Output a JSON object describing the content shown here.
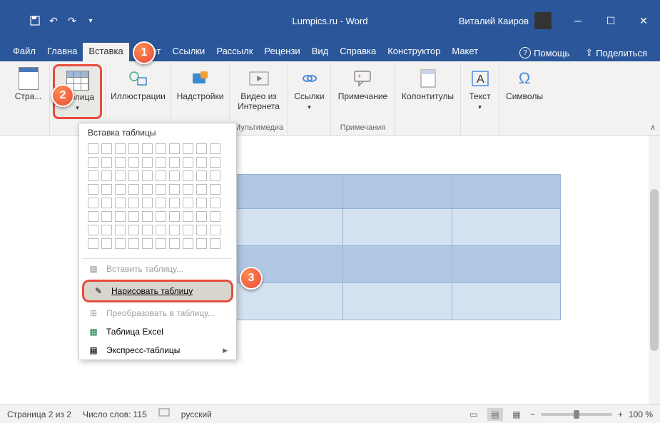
{
  "title": "Lumpics.ru  -  Word",
  "user": "Виталий Каиров",
  "tabs": {
    "items": [
      "Файл",
      "Главна",
      "Вставка",
      "Макет",
      "Ссылки",
      "Рассылк",
      "Рецензи",
      "Вид",
      "Справка",
      "Конструктор",
      "Макет"
    ],
    "active": "Вставка",
    "help": "Помощь",
    "share": "Поделиться"
  },
  "ribbon": {
    "pages": "Стра...",
    "table": "Таблица",
    "illustrations": "Иллюстрации",
    "addins": "Надстройки",
    "video": "Видео из Интернета",
    "multimedia": "Мультимедиа",
    "links": "Ссылки",
    "comment": "Примечание",
    "comments_grp": "Примечания",
    "headers": "Колонтитулы",
    "text": "Текст",
    "symbols": "Символы"
  },
  "dropdown": {
    "header": "Вставка таблицы",
    "insert": "Вставить таблицу...",
    "draw": "Нарисовать таблицу",
    "convert": "Преобразовать в таблицу...",
    "excel": "Таблица Excel",
    "quick": "Экспресс-таблицы"
  },
  "badges": {
    "b1": "1",
    "b2": "2",
    "b3": "3"
  },
  "status": {
    "page": "Страница 2 из 2",
    "words": "Число слов: 115",
    "lang": "русский",
    "zoom": "100 %"
  }
}
